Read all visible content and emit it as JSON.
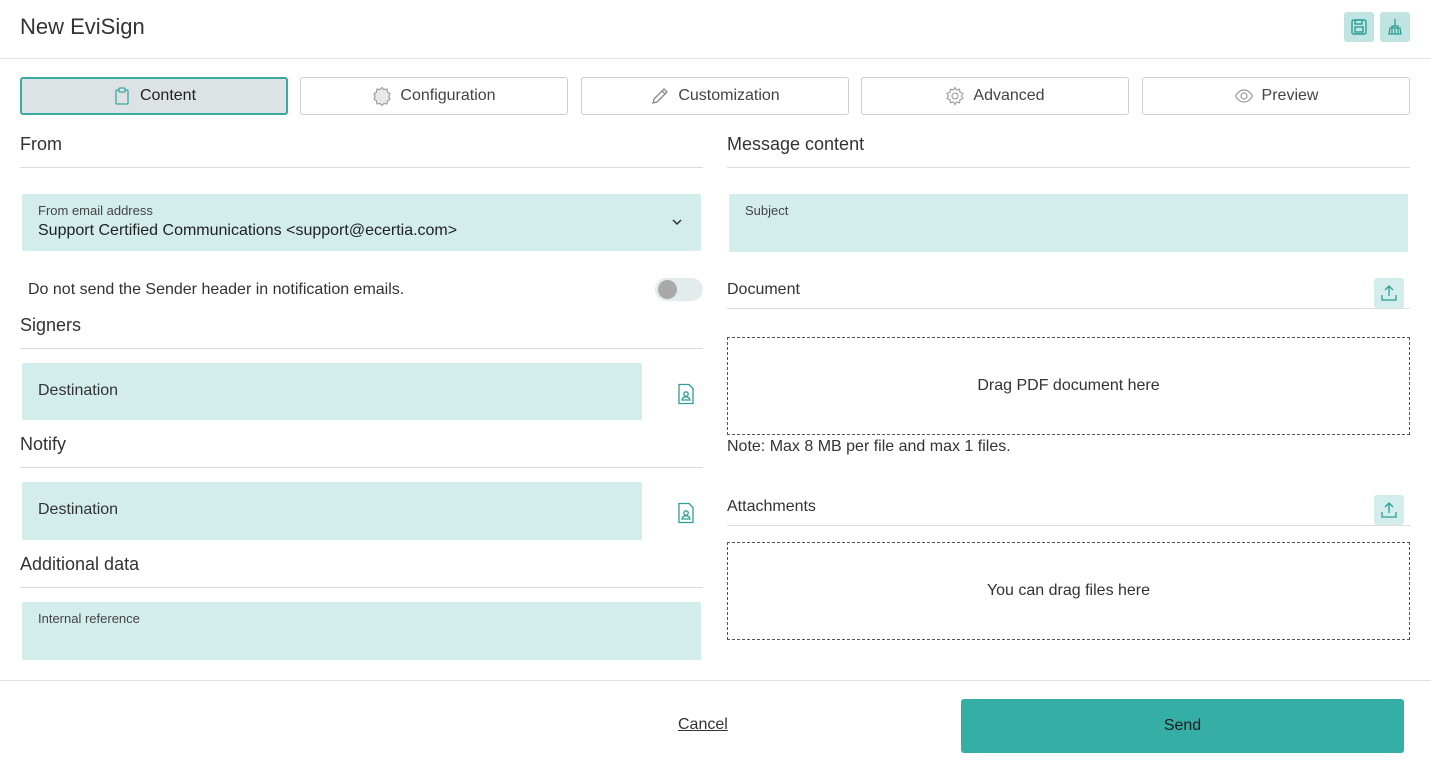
{
  "header": {
    "title": "New EviSign",
    "save_icon": "floppy-disk-icon",
    "clear_icon": "broom-icon",
    "accent": "#35aea6"
  },
  "tabs": [
    {
      "label": "Content",
      "icon": "clipboard-icon",
      "active": true
    },
    {
      "label": "Configuration",
      "icon": "badge-icon",
      "active": false
    },
    {
      "label": "Customization",
      "icon": "pencil-icon",
      "active": false
    },
    {
      "label": "Advanced",
      "icon": "gear-icon",
      "active": false
    },
    {
      "label": "Preview",
      "icon": "eye-icon",
      "active": false
    }
  ],
  "from": {
    "title": "From",
    "email_label": "From email address",
    "email_value": "Support Certified Communications <support@ecertia.com>",
    "sender_toggle_label": "Do not send the Sender header in notification emails.",
    "sender_toggle_on": false
  },
  "signers": {
    "title": "Signers",
    "destination_placeholder": "Destination"
  },
  "notify": {
    "title": "Notify",
    "destination_placeholder": "Destination"
  },
  "additional": {
    "title": "Additional data",
    "internal_reference_label": "Internal reference"
  },
  "message": {
    "title": "Message content",
    "subject_label": "Subject"
  },
  "document": {
    "title": "Document",
    "dropzone_text": "Drag PDF document here",
    "note": "Note: Max 8 MB per file and max 1 files."
  },
  "attachments": {
    "title": "Attachments",
    "dropzone_text": "You can drag files here"
  },
  "footer": {
    "cancel_label": "Cancel",
    "send_label": "Send"
  }
}
